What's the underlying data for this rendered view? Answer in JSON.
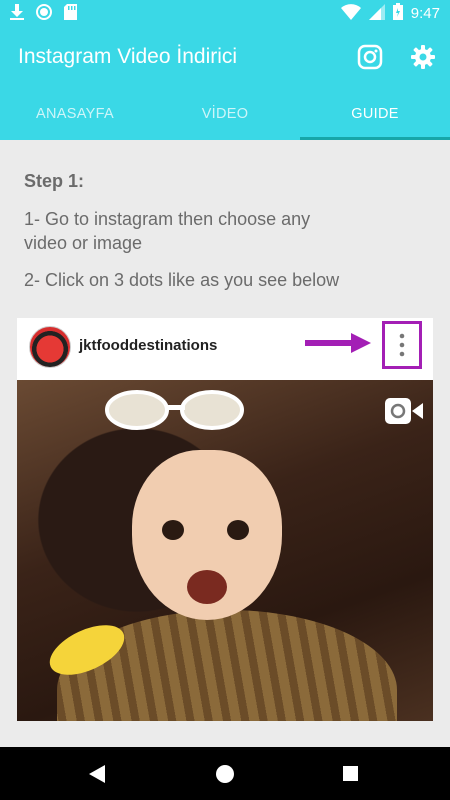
{
  "status_bar": {
    "time": "9:47",
    "icons": [
      "download-icon",
      "circle-icon",
      "sd-card-icon",
      "wifi-icon",
      "signal-icon",
      "battery-icon"
    ]
  },
  "app_bar": {
    "title": "Instagram Video İndirici",
    "icons": [
      "instagram-icon",
      "settings-icon"
    ]
  },
  "tabs": [
    {
      "label": "ANASAYFA"
    },
    {
      "label": "VİDEO"
    },
    {
      "label": "GUIDE",
      "active": true
    }
  ],
  "guide": {
    "step_title": "Step 1:",
    "instruction_1": "1- Go to instagram then choose any video or image",
    "instruction_2": "2- Click on 3 dots like as you see below",
    "example_post": {
      "username": "jktfooddestinations",
      "media_type_icon": "video-camera-icon"
    }
  },
  "colors": {
    "primary": "#3ad8e6",
    "tab_indicator": "#17a6a8",
    "highlight": "#a31fb5"
  },
  "nav_bar": {
    "icons": [
      "back-icon",
      "home-icon",
      "recents-icon"
    ]
  }
}
